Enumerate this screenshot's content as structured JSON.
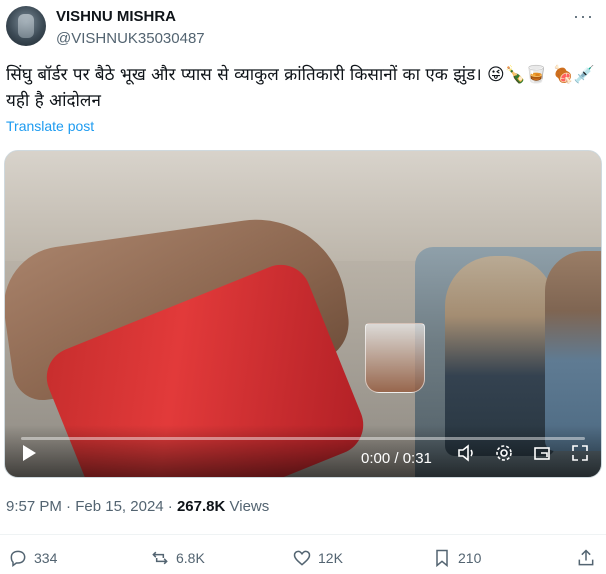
{
  "author": {
    "name": "VISHNU MISHRA",
    "handle": "@VISHNUK35030487"
  },
  "more_icon": "ellipsis-icon",
  "tweet": {
    "text": "सिंघु बॉर्डर पर बैठे भूख और प्यास से व्याकुल क्रांतिकारी किसानों का एक झुंड। 😜🍾🥃 🍖💉 यही है आंदोलन",
    "translate_label": "Translate post"
  },
  "video": {
    "time_display": "0:00 / 0:31",
    "progress_fraction": 0.0
  },
  "meta": {
    "time": "9:57 PM",
    "date": "Feb 15, 2024",
    "views_count": "267.8K",
    "views_label": "Views"
  },
  "actions": {
    "replies": "334",
    "reposts": "6.8K",
    "likes": "12K",
    "bookmarks": "210"
  },
  "colors": {
    "accent": "#1d9bf0",
    "secondary_text": "#536471"
  }
}
